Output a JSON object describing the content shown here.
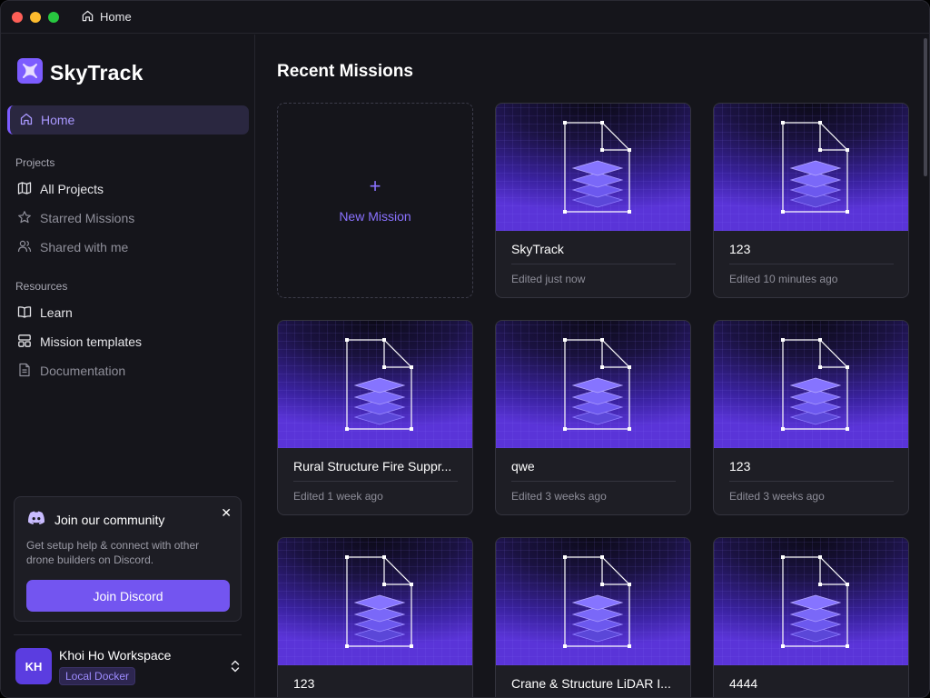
{
  "window": {
    "tab_title": "Home",
    "tab_icon": "home-icon"
  },
  "brand": {
    "name": "SkyTrack",
    "logo_color": "#7c5cff"
  },
  "sidebar": {
    "home_label": "Home",
    "projects_heading": "Projects",
    "projects_items": [
      {
        "label": "All Projects",
        "icon": "map-icon"
      },
      {
        "label": "Starred Missions",
        "icon": "star-icon"
      },
      {
        "label": "Shared with me",
        "icon": "users-icon"
      }
    ],
    "resources_heading": "Resources",
    "resources_items": [
      {
        "label": "Learn",
        "icon": "book-icon"
      },
      {
        "label": "Mission templates",
        "icon": "template-icon"
      },
      {
        "label": "Documentation",
        "icon": "document-icon"
      }
    ]
  },
  "community": {
    "title": "Join our community",
    "description": "Get setup help & connect with other drone builders on Discord.",
    "button_label": "Join Discord",
    "close_glyph": "✕"
  },
  "workspace": {
    "initials": "KH",
    "name": "Khoi Ho Workspace",
    "badge": "Local Docker"
  },
  "main": {
    "title": "Recent Missions",
    "new_mission": {
      "plus": "+",
      "label": "New Mission"
    },
    "missions": [
      {
        "name": "SkyTrack",
        "edited": "Edited just now"
      },
      {
        "name": "123",
        "edited": "Edited 10 minutes ago"
      },
      {
        "name": "Rural Structure Fire Suppr...",
        "edited": "Edited 1 week ago"
      },
      {
        "name": "qwe",
        "edited": "Edited 3 weeks ago"
      },
      {
        "name": "123",
        "edited": "Edited 3 weeks ago"
      },
      {
        "name": "123",
        "edited": ""
      },
      {
        "name": "Crane & Structure LiDAR I...",
        "edited": ""
      },
      {
        "name": "4444",
        "edited": ""
      }
    ]
  },
  "colors": {
    "accent": "#7c5cff",
    "background": "#15151b",
    "card": "#1e1e25"
  }
}
